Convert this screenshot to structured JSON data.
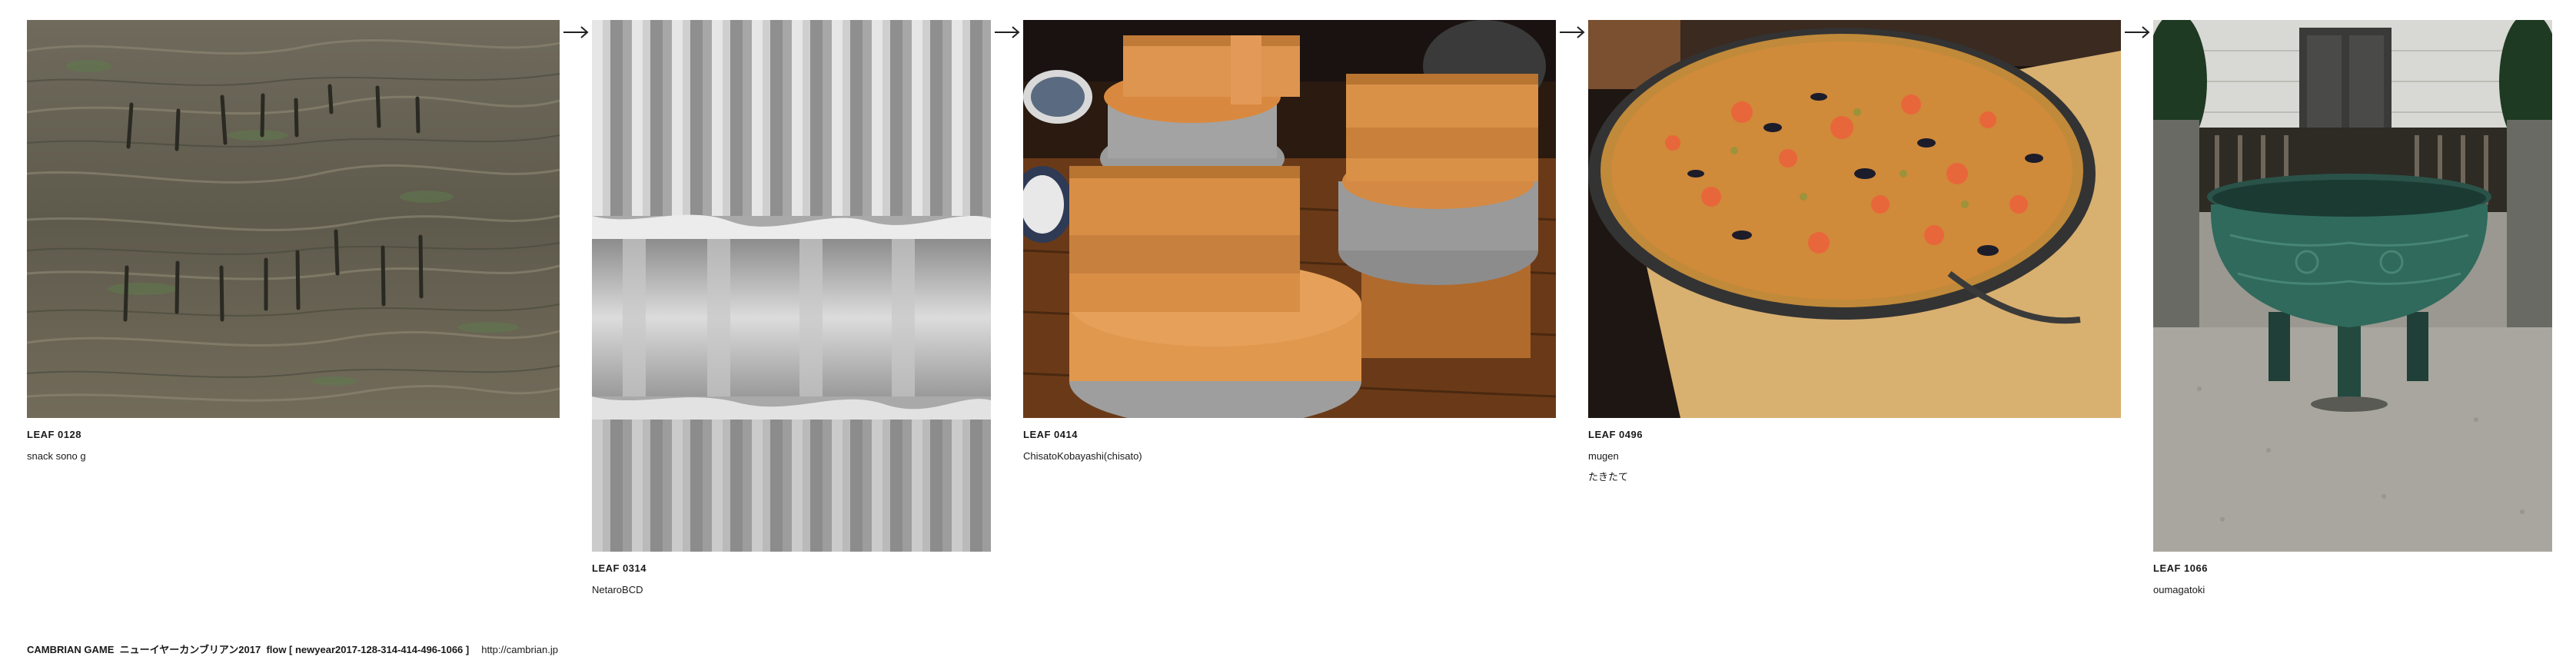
{
  "leaves": [
    {
      "number": "LEAF 0128",
      "author": "snack sono g",
      "caption": "",
      "image": "tree-bark-carved-marks"
    },
    {
      "number": "LEAF 0314",
      "author": "NetaroBCD",
      "caption": "",
      "image": "corrugated-metal-sheet"
    },
    {
      "number": "LEAF 0414",
      "author": "ChisatoKobayashi(chisato)",
      "caption": "",
      "image": "wooden-lidded-rice-pots"
    },
    {
      "number": "LEAF 0496",
      "author": "mugen",
      "caption": "たきたて",
      "image": "paella-pan"
    },
    {
      "number": "LEAF 1066",
      "author": "oumagatoki",
      "caption": "",
      "image": "bronze-tripod-cauldron"
    }
  ],
  "arrow_icon": "right-arrow-icon",
  "footer": {
    "text": "CAMBRIAN GAME  ニューイヤーカンブリアン2017  flow [ newyear2017-128-314-414-496-1066 ]",
    "link": "http://cambrian.jp"
  }
}
